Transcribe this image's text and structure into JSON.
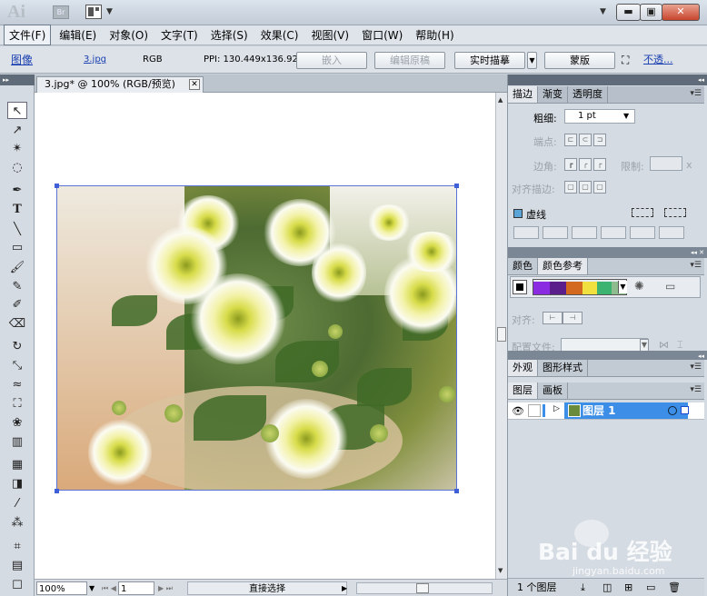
{
  "app": {
    "logo_text": "Ai",
    "bridge_label": "Br"
  },
  "window_buttons": {
    "minimize": "▬",
    "maximize": "▣",
    "close": "✕"
  },
  "menu": [
    "文件(F)",
    "编辑(E)",
    "对象(O)",
    "文字(T)",
    "选择(S)",
    "效果(C)",
    "视图(V)",
    "窗口(W)",
    "帮助(H)"
  ],
  "control": {
    "object_type": "图像",
    "file_link": "3.jpg",
    "color_mode": "RGB",
    "ppi": "PPI: 130.449x136.929",
    "embed_label": "嵌入",
    "edit_original_label": "编辑原稿",
    "live_trace_label": "实时描摹",
    "mask_label": "蒙版",
    "opacity_link": "不透..."
  },
  "document": {
    "tab_title": "3.jpg* @ 100% (RGB/预览)",
    "close": "✕"
  },
  "tools": [
    "selection-tool-icon",
    "direct-selection-tool-icon",
    "magic-wand-tool-icon",
    "lasso-tool-icon",
    "pen-tool-icon",
    "type-tool-icon",
    "line-tool-icon",
    "rectangle-tool-icon",
    "paintbrush-tool-icon",
    "pencil-tool-icon",
    "blob-brush-tool-icon",
    "eraser-tool-icon",
    "rotate-tool-icon",
    "scale-tool-icon",
    "warp-tool-icon",
    "free-transform-tool-icon",
    "symbol-sprayer-tool-icon",
    "column-graph-tool-icon",
    "mesh-tool-icon",
    "gradient-tool-icon",
    "eyedropper-tool-icon",
    "blend-tool-icon",
    "slice-tool-icon",
    "hand-tool-icon"
  ],
  "tool_type_glyph": "T",
  "status": {
    "zoom": "100%",
    "page": "1",
    "tool_name": "直接选择"
  },
  "stroke_panel": {
    "tabs": [
      "描边",
      "渐变",
      "透明度"
    ],
    "weight_label": "粗细:",
    "weight_value": "1 pt",
    "cap_label": "端点:",
    "corner_label": "边角:",
    "limit_label": "限制:",
    "limit_x": "x",
    "align_label": "对齐描边:",
    "dashed_label": "虚线"
  },
  "color_panel": {
    "tabs": [
      "颜色",
      "颜色参考"
    ],
    "swatches": [
      "#8a2be2",
      "#5b1f8c",
      "#d2691e",
      "#f0e040",
      "#3cb371",
      "#8fbc8f"
    ]
  },
  "align_panel": {
    "align_label": "对齐:",
    "profile_label": "配置文件:"
  },
  "appearance_panel": {
    "tabs": [
      "外观",
      "图形样式"
    ]
  },
  "layers_panel": {
    "tabs": [
      "图层",
      "画板"
    ],
    "layer_name": "图层 1",
    "layer_color": "#3d8ee6",
    "count": "1 个图层"
  },
  "watermark": {
    "brand": "Bai du 经验",
    "url": "jingyan.baidu.com"
  }
}
